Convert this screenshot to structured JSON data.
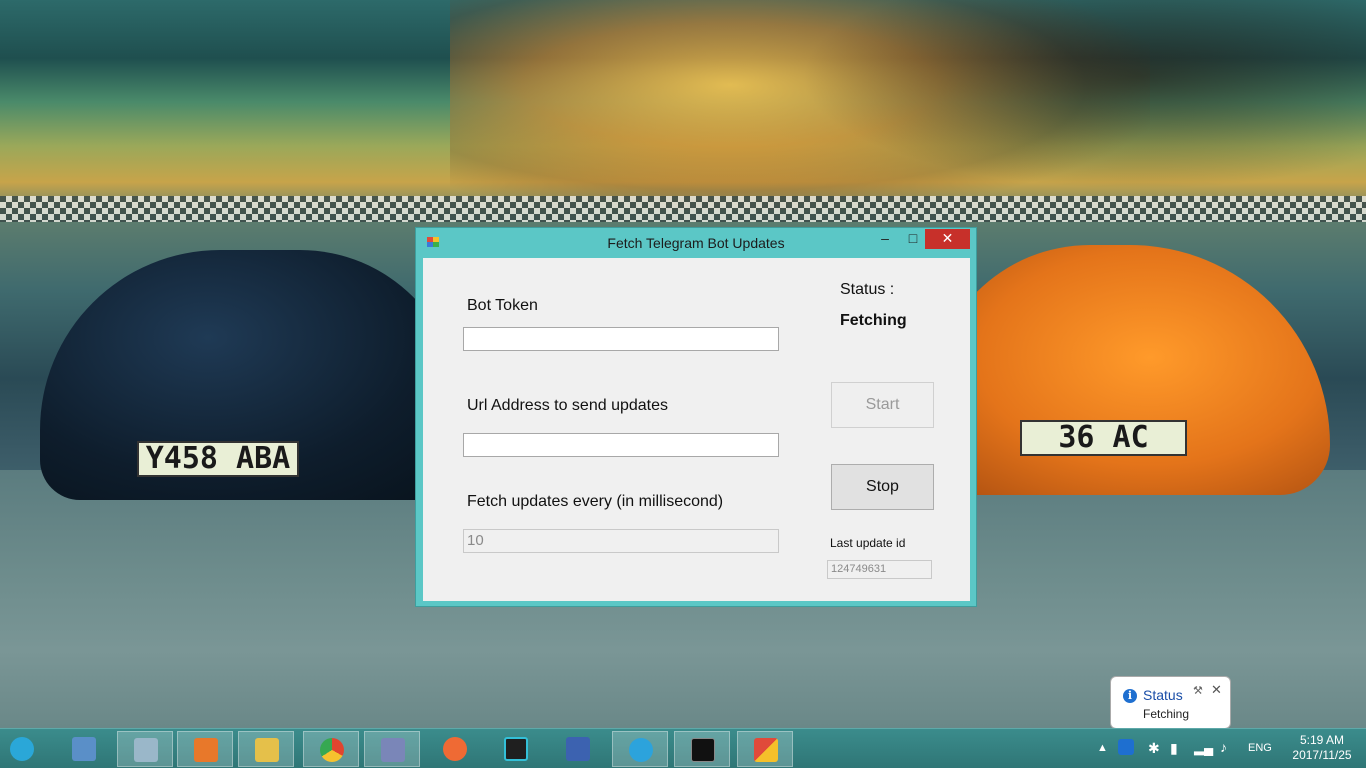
{
  "window": {
    "title": "Fetch Telegram Bot Updates",
    "minimize": "–",
    "maximize": "□",
    "close": "✕"
  },
  "form": {
    "bot_token_label": "Bot Token",
    "bot_token_value": "",
    "url_label": "Url Address to send updates",
    "url_value": "",
    "interval_label": "Fetch updates every   (in millisecond)",
    "interval_value": "10",
    "status_label": "Status :",
    "status_value": "Fetching",
    "start_label": "Start",
    "stop_label": "Stop",
    "last_update_label": "Last update id",
    "last_update_value": "124749631"
  },
  "wallpaper": {
    "plate_left": "Y458 ABA",
    "plate_right": "36 AC"
  },
  "notification": {
    "title": "Status",
    "text": "Fetching",
    "icon": "info-icon",
    "close": "✕"
  },
  "taskbar": {
    "items": [
      {
        "name": "people-icon",
        "color": "#2aa7d8"
      },
      {
        "name": "remote-desktop-icon",
        "color": "#5a8fc8"
      },
      {
        "name": "performance-monitor-icon",
        "color": "#9ab7c9"
      },
      {
        "name": "media-player-icon",
        "color": "#e8782a"
      },
      {
        "name": "file-explorer-icon",
        "color": "#e5c04a"
      },
      {
        "name": "chrome-icon",
        "color": "#e0452f"
      },
      {
        "name": "php-icon",
        "color": "#7a86b8"
      },
      {
        "name": "postman-icon",
        "color": "#ef6a34"
      },
      {
        "name": "webstorm-icon",
        "color": "#1f1f1f"
      },
      {
        "name": "network-tool-icon",
        "color": "#3c62b0"
      },
      {
        "name": "telegram-icon",
        "color": "#2ca3dc"
      },
      {
        "name": "command-prompt-icon",
        "color": "#111111"
      },
      {
        "name": "windows-forms-app-icon",
        "color": "#f2a12a"
      }
    ],
    "language": "ENG",
    "time": "5:19 AM",
    "date": "2017/11/25"
  }
}
